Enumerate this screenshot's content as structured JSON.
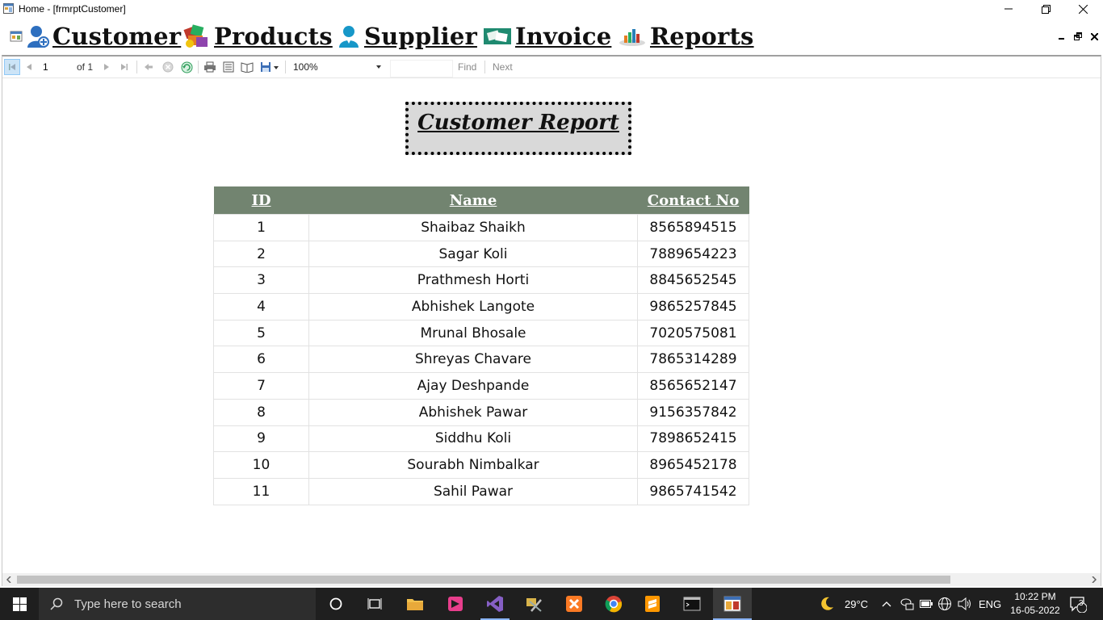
{
  "window": {
    "title": "Home - [frmrptCustomer]"
  },
  "menu": {
    "items": [
      {
        "label": "Customer",
        "icon": "customer-icon"
      },
      {
        "label": "Products",
        "icon": "products-icon"
      },
      {
        "label": "Supplier",
        "icon": "supplier-icon"
      },
      {
        "label": "Invoice",
        "icon": "invoice-icon"
      },
      {
        "label": "Reports",
        "icon": "reports-icon"
      }
    ]
  },
  "toolbar": {
    "page_current": "1",
    "page_total_label": "of 1",
    "zoom": "100%",
    "find_label": "Find",
    "next_label": "Next"
  },
  "report": {
    "title": "Customer Report",
    "columns": [
      "ID",
      "Name",
      "Contact No"
    ],
    "rows": [
      [
        "1",
        "Shaibaz Shaikh",
        "8565894515"
      ],
      [
        "2",
        "Sagar Koli",
        "7889654223"
      ],
      [
        "3",
        "Prathmesh Horti",
        "8845652545"
      ],
      [
        "4",
        "Abhishek Langote",
        "9865257845"
      ],
      [
        "5",
        "Mrunal Bhosale",
        "7020575081"
      ],
      [
        "6",
        "Shreyas Chavare",
        "7865314289"
      ],
      [
        "7",
        "Ajay Deshpande",
        "8565652147"
      ],
      [
        "8",
        "Abhishek Pawar",
        "9156357842"
      ],
      [
        "9",
        "Siddhu Koli",
        "7898652415"
      ],
      [
        "10",
        "Sourabh Nimbalkar",
        "8965452178"
      ],
      [
        "11",
        "Sahil Pawar",
        "9865741542"
      ]
    ]
  },
  "taskbar": {
    "search_placeholder": "Type here to search",
    "weather": "29°C",
    "language": "ENG",
    "time": "10:22 PM",
    "date": "16-05-2022",
    "notification_count": "3"
  },
  "colors": {
    "header_bg": "#728470",
    "title_box_bg": "#d9d9d9",
    "taskbar_bg": "#1f1f1f"
  }
}
